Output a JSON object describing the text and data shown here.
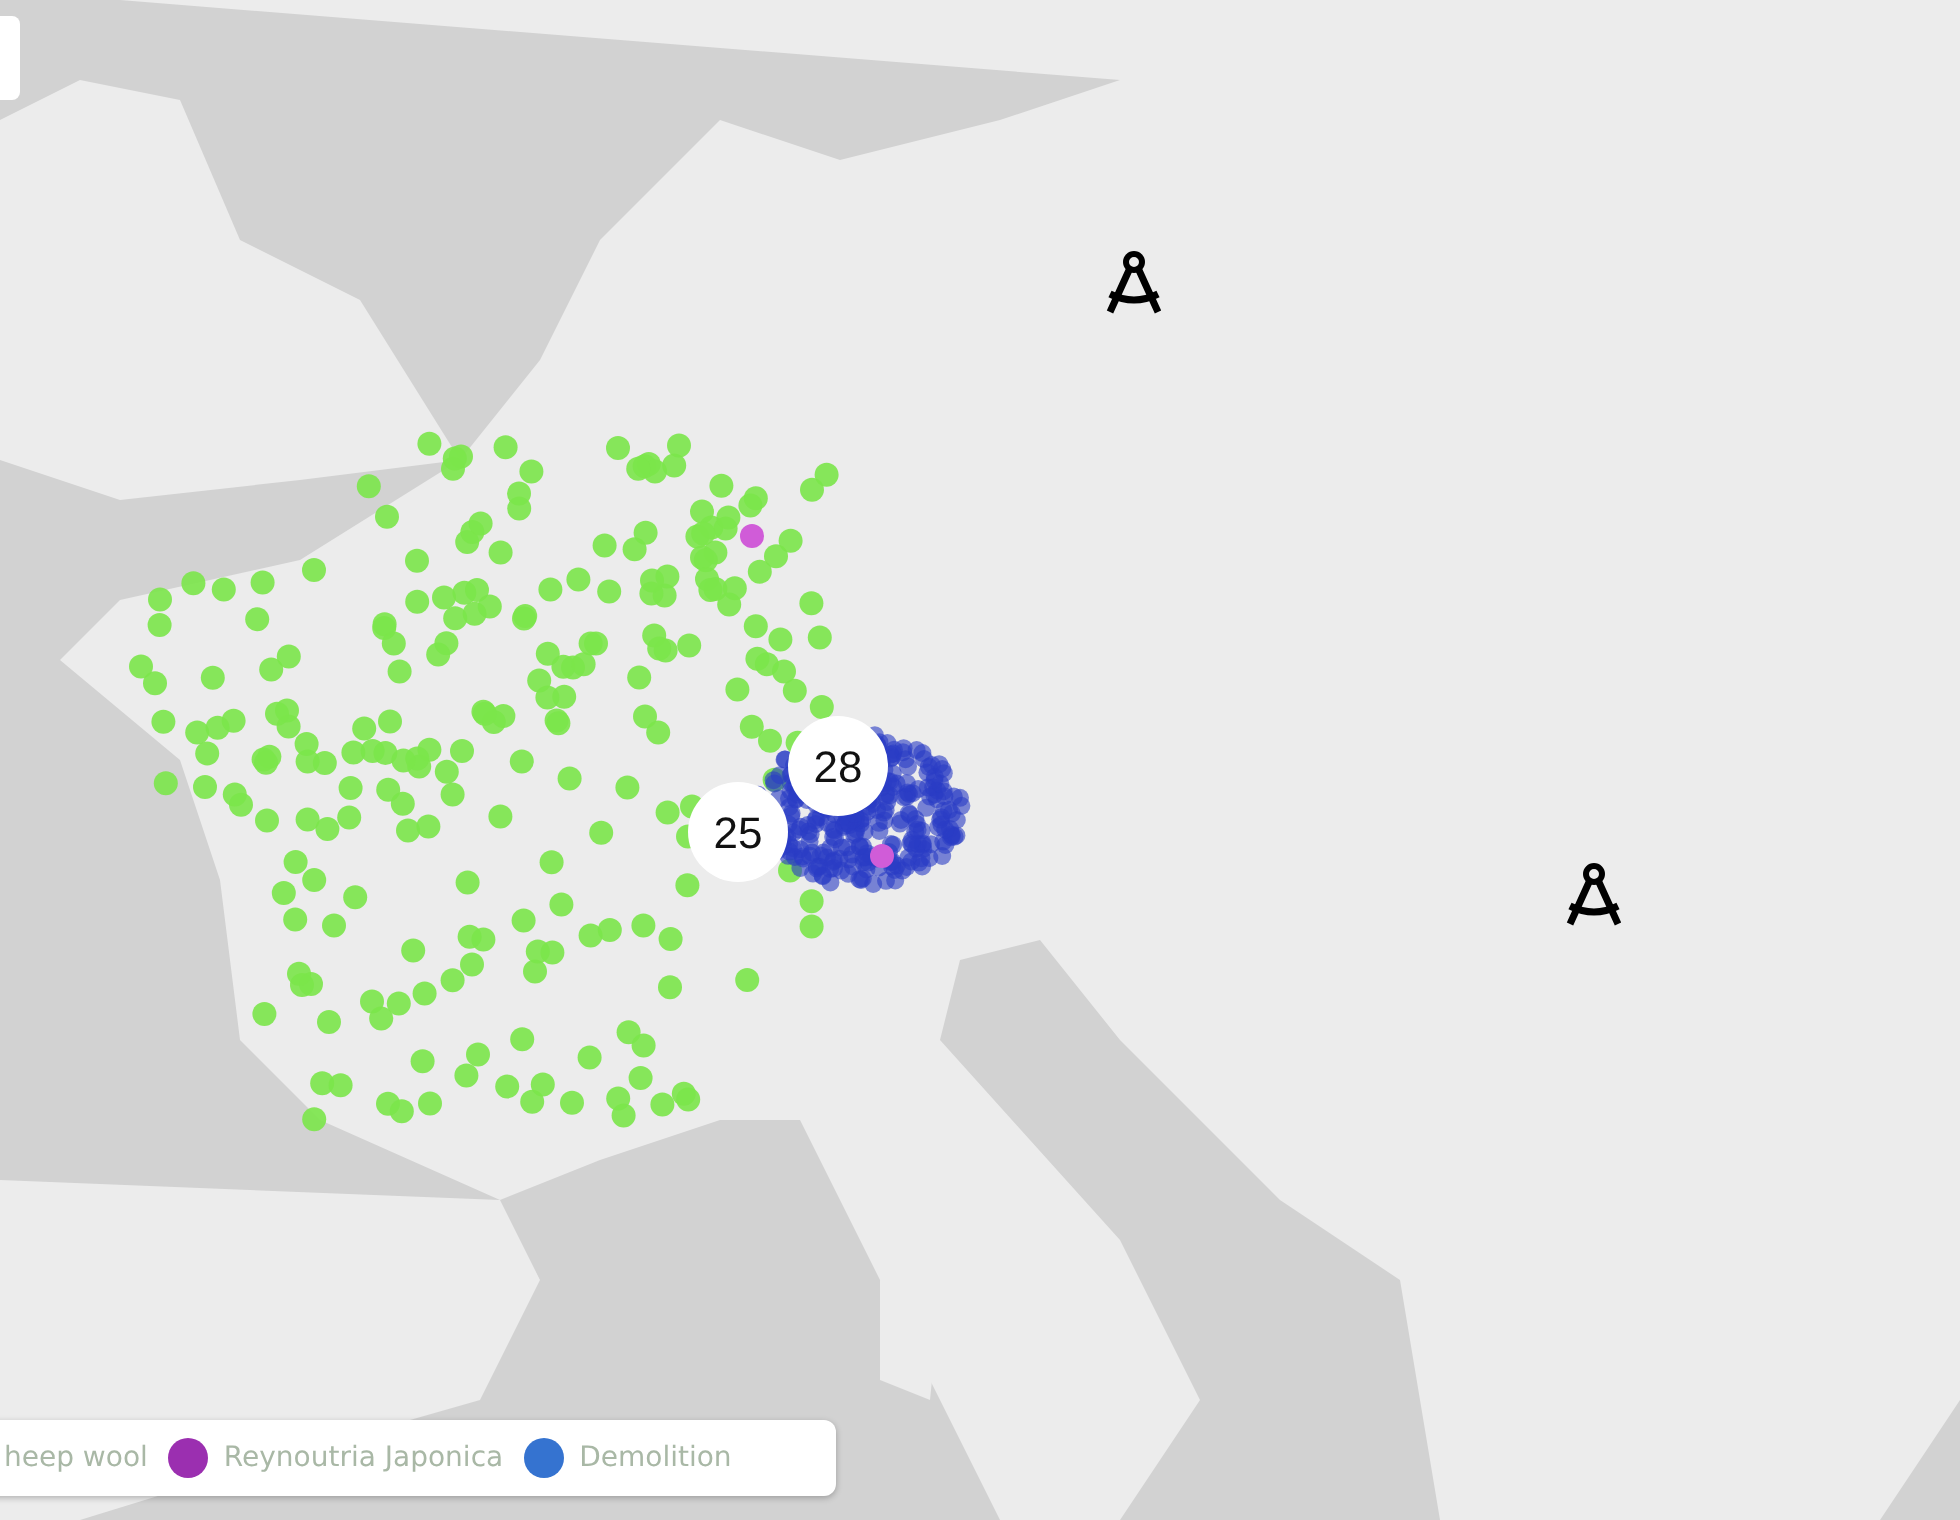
{
  "map": {
    "clusters": [
      {
        "count": "28"
      },
      {
        "count": "25"
      }
    ]
  },
  "legend": {
    "items": [
      {
        "label": "heep wool"
      },
      {
        "label": "Reynoutria Japonica",
        "color": "#9b2fb0"
      },
      {
        "label": "Demolition",
        "color": "#3573d0"
      }
    ]
  }
}
